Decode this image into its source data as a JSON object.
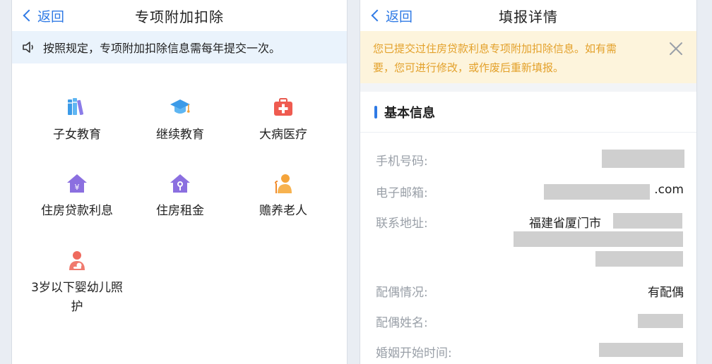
{
  "left": {
    "back_label": "返回",
    "title": "专项附加扣除",
    "notice": "按照规定，专项附加扣除信息需每年提交一次。",
    "categories": [
      {
        "label": "子女教育",
        "icon": "books-icon"
      },
      {
        "label": "继续教育",
        "icon": "graduation-cap-icon"
      },
      {
        "label": "大病医疗",
        "icon": "medical-kit-icon"
      },
      {
        "label": "住房贷款利息",
        "icon": "house-yen-icon"
      },
      {
        "label": "住房租金",
        "icon": "house-key-icon"
      },
      {
        "label": "赡养老人",
        "icon": "elder-icon"
      },
      {
        "label": "3岁以下婴幼儿照",
        "label2": "护",
        "icon": "mother-baby-icon"
      }
    ]
  },
  "right": {
    "back_label": "返回",
    "title": "填报详情",
    "warning_line1": "您已提交过住房贷款利息专项附加扣除信息。如有需",
    "warning_line2": "要，您可进行修改，或作废后重新填报。",
    "section_title": "基本信息",
    "fields": {
      "phone_label": "手机号码:",
      "email_label": "电子邮箱:",
      "email_suffix": ".com",
      "address_label": "联系地址:",
      "address_value": "福建省厦门市",
      "spouse_status_label": "配偶情况:",
      "spouse_status_value": "有配偶",
      "spouse_name_label": "配偶姓名:",
      "marriage_date_label": "婚姻开始时间:"
    }
  },
  "colors": {
    "accent": "#2f7ae5",
    "notice_bg": "#eaf3fc",
    "warning_bg": "#fdf4dc",
    "warning_text": "#e3a12b",
    "mask": "#cfcfcf"
  }
}
